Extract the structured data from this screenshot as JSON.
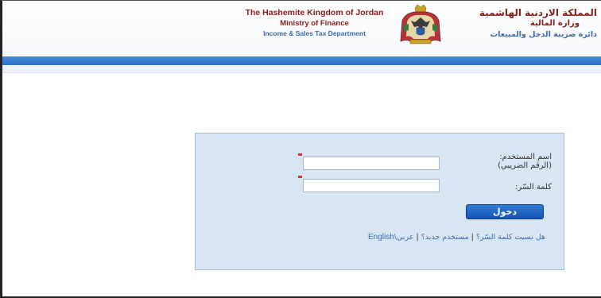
{
  "header": {
    "en_title": "The Hashemite Kingdom of Jordan",
    "en_ministry": "Ministry of Finance",
    "en_department": "Income & Sales Tax Department",
    "ar_title": "المملكة الاردنية الهاشمية",
    "ar_ministry": "وزارة المالية",
    "ar_department": "دائرة ضريبة الدخل والمبيعات",
    "emblem_icon": "jordan-coat-of-arms-icon"
  },
  "login": {
    "username_label_line1": "اسم المستخدم:",
    "username_label_line2": "(الرقم الضريبي)",
    "username_value": "",
    "password_label": "كلمة السّر:",
    "password_value": "",
    "submit_label": "دخول"
  },
  "links": {
    "forgot_password": "هل نسيت كلمة السّر؟",
    "separator": "|",
    "new_user": "مستخدم جديد؟",
    "language_arabic": "عربي",
    "language_divider": "\\",
    "language_english": "English"
  },
  "colors": {
    "accent_blue": "#2a6ec4",
    "header_red": "#8b1c1c",
    "login_box": "#d7e6f2",
    "required_marker": "#e03030"
  }
}
